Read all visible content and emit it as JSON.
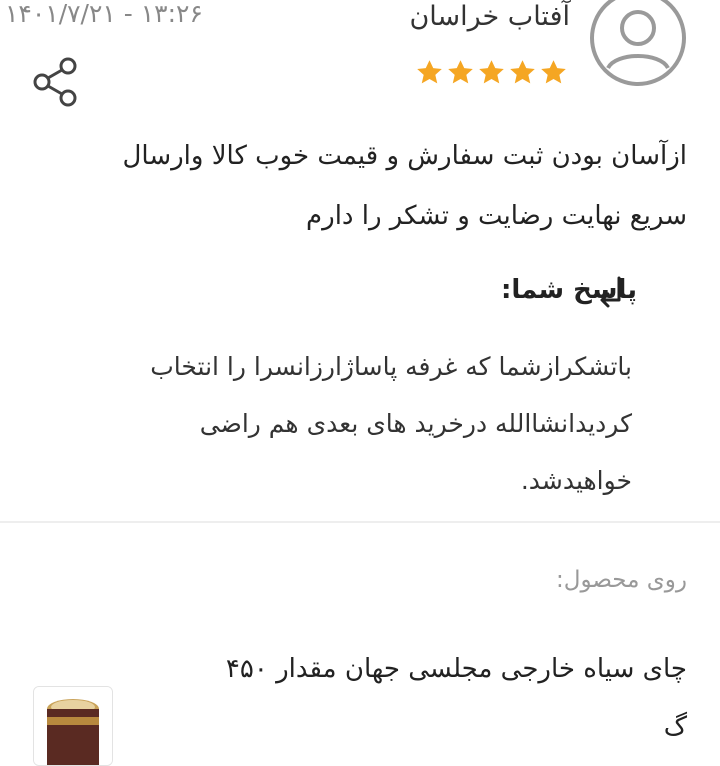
{
  "review": {
    "author": "آفتاب خراسان",
    "datetime": "۱۴۰۱/۷/۲۱ - ۱۳:۲۶",
    "rating": 5,
    "rating_max": 5,
    "star_color": "#f5a623",
    "avatar_icon": "user-avatar-icon",
    "share_icon": "share-icon",
    "comment_lines": [
      "ازآسان بودن ثبت سفارش و قیمت خوب کالا وارسال",
      "سریع نهایت رضایت و تشکر را دارم"
    ]
  },
  "reply": {
    "title": "پاسخ شما:",
    "icon": "reply-arrow-icon",
    "body_lines": [
      "باتشکرازشما که غرفه پاساژارزانسرا را انتخاب",
      "کردیدانشاالله درخرید های بعدی هم راضی",
      "خواهیدشد."
    ]
  },
  "product": {
    "section_label": "روی محصول:",
    "title_lines": [
      "چای سیاه خارجی مجلسی جهان مقدار ۴۵۰",
      "گ"
    ],
    "thumbnail_icon": "product-thumbnail"
  }
}
